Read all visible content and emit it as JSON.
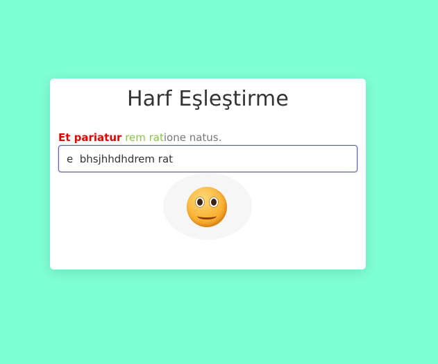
{
  "title": "Harf Eşleştirme",
  "sentence": {
    "wrong": "Et pariatur",
    "correct": "rem rat",
    "rest": "ione natus."
  },
  "input": {
    "value": "e  bhsjhhdhdrem rat"
  },
  "feedback": {
    "icon": "smiling-face-emoji"
  },
  "colors": {
    "background": "#7fffd4",
    "wrong": "#e00000",
    "correct": "#8bc34a"
  }
}
